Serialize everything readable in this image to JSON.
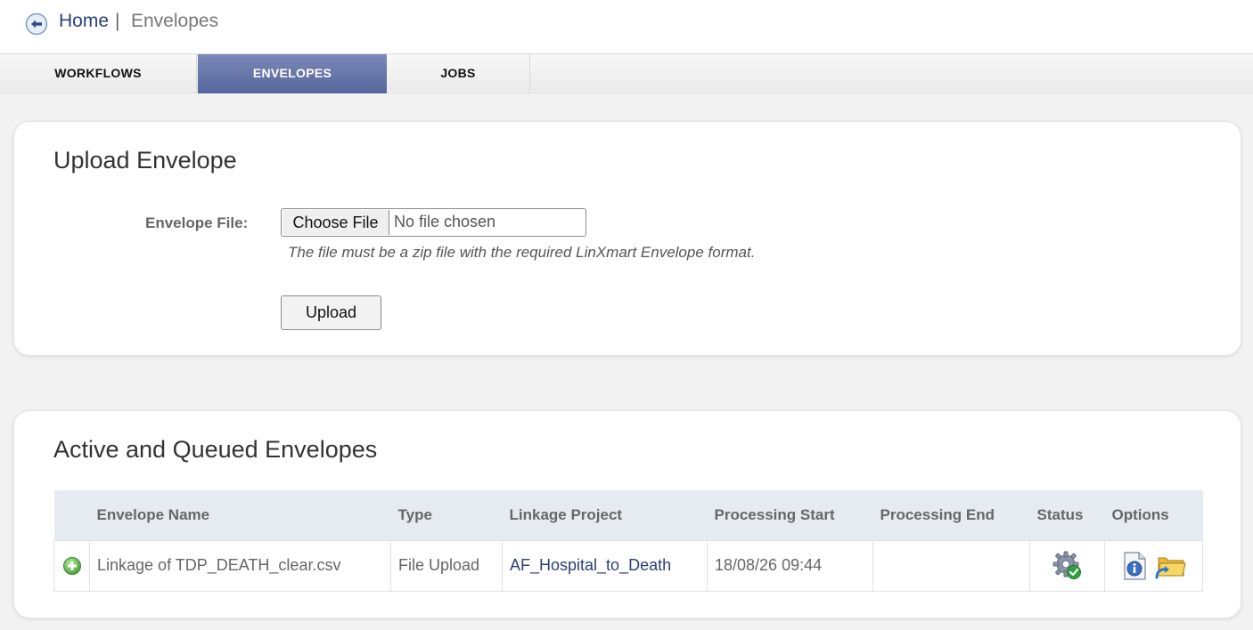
{
  "breadcrumb": {
    "home": "Home",
    "separator": "|",
    "current": "Envelopes"
  },
  "tabs": [
    {
      "label": "WORKFLOWS",
      "active": false
    },
    {
      "label": "ENVELOPES",
      "active": true
    },
    {
      "label": "JOBS",
      "active": false
    }
  ],
  "upload": {
    "title": "Upload Envelope",
    "field_label": "Envelope File:",
    "choose_button": "Choose File",
    "file_status": "No file chosen",
    "hint": "The file must be a zip file with the required LinXmart Envelope format.",
    "upload_button": "Upload"
  },
  "active": {
    "title": "Active and Queued Envelopes",
    "columns": [
      "Envelope Name",
      "Type",
      "Linkage Project",
      "Processing Start",
      "Processing End",
      "Status",
      "Options"
    ],
    "rows": [
      {
        "expand_icon": "plus-circle-icon",
        "name": "Linkage of TDP_DEATH_clear.csv",
        "type": "File Upload",
        "project": "AF_Hospital_to_Death",
        "start": "18/08/26 09:44",
        "end": "",
        "status_icon": "gear-check-icon",
        "option_icons": [
          "info-document-icon",
          "folder-refresh-icon"
        ]
      }
    ]
  },
  "colors": {
    "accent": "#56659c",
    "link": "#2b3f7a",
    "header_bg": "#e6ebf2"
  }
}
